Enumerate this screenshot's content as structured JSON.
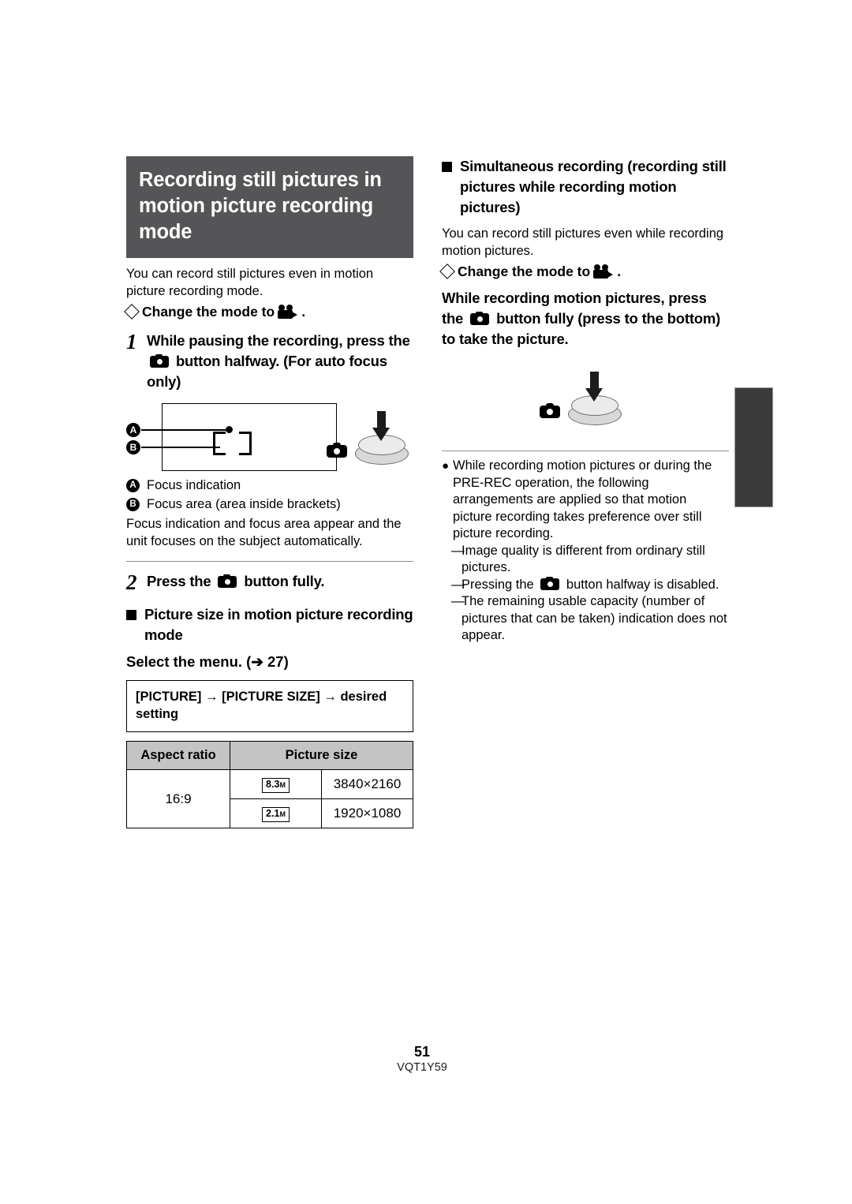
{
  "document": {
    "page_number": "51",
    "doc_code": "VQT1Y59"
  },
  "left_column": {
    "banner_title": "Recording still pictures in motion picture recording mode",
    "intro": "You can record still pictures even in motion picture recording mode.",
    "change_mode_label": "Change the mode to",
    "change_mode_period": ".",
    "step1": {
      "number": "1",
      "text_before_icon": "While pausing the recording, press the",
      "text_after_icon": "button halfway. (For auto focus only)"
    },
    "figure": {
      "callout_a": "A",
      "callout_b": "B"
    },
    "legend": [
      {
        "marker": "A",
        "text": "Focus indication"
      },
      {
        "marker": "B",
        "text": "Focus area (area inside brackets)"
      }
    ],
    "legend_note": "Focus indication and focus area appear and the unit focuses on the subject automatically.",
    "step2": {
      "number": "2",
      "text_before_icon": "Press the",
      "text_after_icon": "button fully."
    },
    "picture_size_heading": "Picture size in motion picture recording mode",
    "select_menu_before": "Select the menu. (",
    "select_menu_arrow": "➔",
    "select_menu_page": "27",
    "select_menu_after": ")",
    "menu_box": {
      "item1": "[PICTURE]",
      "arrow1": "→",
      "item2": "[PICTURE SIZE]",
      "arrow2": "→",
      "item3": "desired setting"
    },
    "table": {
      "headers": [
        "Aspect ratio",
        "Picture size"
      ],
      "aspect_ratio": "16:9",
      "rows": [
        {
          "chip": "8.3",
          "chip_unit": "M",
          "size": "3840×2160"
        },
        {
          "chip": "2.1",
          "chip_unit": "M",
          "size": "1920×1080"
        }
      ]
    }
  },
  "right_column": {
    "heading": "Simultaneous recording (recording still pictures while recording motion pictures)",
    "intro": "You can record still pictures even while recording motion pictures.",
    "change_mode_label": "Change the mode to",
    "change_mode_period": ".",
    "instruction_before_icon": "While recording motion pictures, press the",
    "instruction_after_icon": "button fully (press to the bottom) to take the picture.",
    "bullet": "While recording motion pictures or during the PRE-REC operation, the following arrangements are applied so that motion picture recording takes preference over still picture recording.",
    "dash_items": [
      {
        "text": "Image quality is different from ordinary still pictures."
      },
      {
        "text_before_icon": "Pressing the",
        "text_after_icon": "button halfway is disabled."
      },
      {
        "text": "The remaining usable capacity (number of pictures that can be taken) indication does not appear."
      }
    ]
  },
  "colors": {
    "banner_bg": "#555558",
    "table_header_bg": "#c4c4c4",
    "edge_tab_bg": "#3a3a3a"
  }
}
